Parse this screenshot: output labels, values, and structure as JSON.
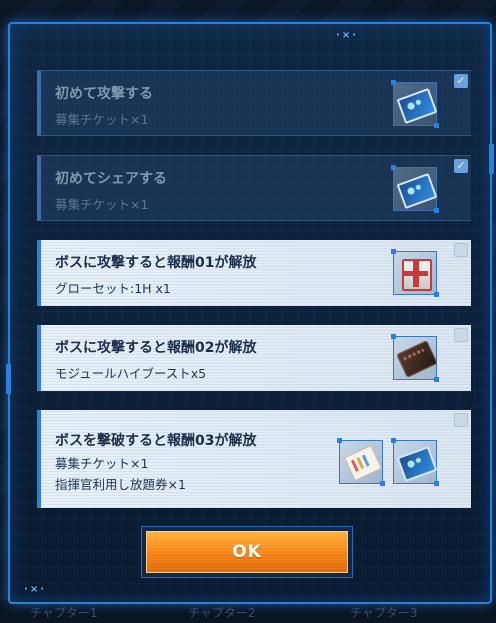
{
  "bottom_tabs": [
    "チャプター1",
    "チャプター2",
    "チャプター3"
  ],
  "missions": [
    {
      "title": "初めて攻撃する",
      "rewards": [
        "募集チケット×1"
      ],
      "completed": true,
      "items": [
        "recruit-ticket"
      ]
    },
    {
      "title": "初めてシェアする",
      "rewards": [
        "募集チケット×1"
      ],
      "completed": true,
      "items": [
        "recruit-ticket"
      ]
    },
    {
      "title": "ボスに攻撃すると報酬01が解放",
      "rewards": [
        "グローセット:1H x1"
      ],
      "completed": false,
      "items": [
        "glow-set-crate"
      ]
    },
    {
      "title": "ボスに攻撃すると報酬02が解放",
      "rewards": [
        "モジュールハイブーストx5"
      ],
      "completed": false,
      "items": [
        "module-high-boost"
      ]
    },
    {
      "title": "ボスを撃破すると報酬03が解放",
      "rewards": [
        "募集チケット×1",
        "指揮官利用し放題券×1"
      ],
      "completed": false,
      "items": [
        "commander-unlimited-pass",
        "recruit-ticket"
      ]
    }
  ],
  "check_glyph": "✓",
  "ok_button": {
    "label": "OK"
  },
  "corner_deco": "×",
  "colors": {
    "panel_border": "#2b7fd8",
    "ok_button": "#f58214",
    "active_row_bg": "#e8f0f8"
  }
}
